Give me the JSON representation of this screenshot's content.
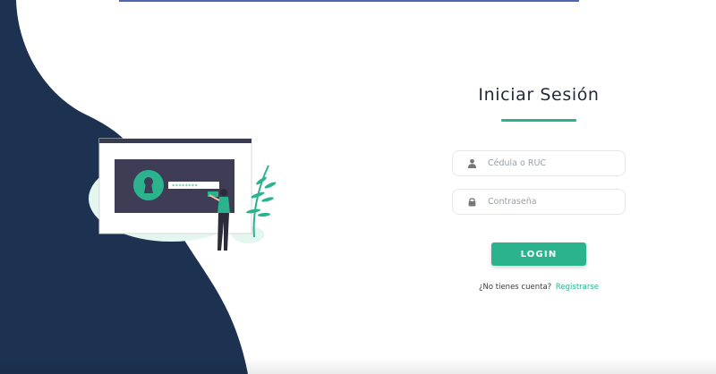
{
  "colors": {
    "accent": "#2bb38e",
    "dark_wave": "#1d3250",
    "top_bar": "#2f4ca0"
  },
  "login": {
    "title": "Iniciar Sesión",
    "id_field": {
      "icon": "user-icon",
      "placeholder": "Cédula o RUC",
      "value": ""
    },
    "password_field": {
      "icon": "lock-icon",
      "placeholder": "Contraseña",
      "value": ""
    },
    "button_label": "LOGIN",
    "register_prompt": "¿No tienes cuenta?",
    "register_link": "Registrarse"
  },
  "illustration": {
    "icon": "keyhole-icon",
    "password_mask": "********"
  }
}
